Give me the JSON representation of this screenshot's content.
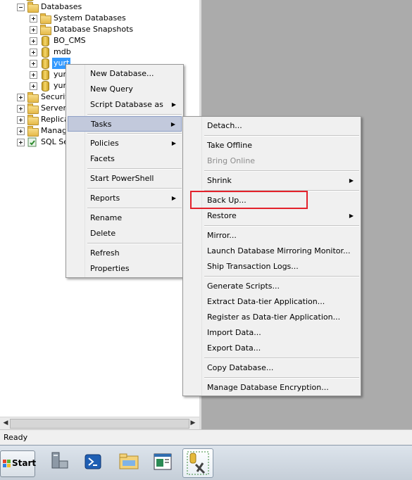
{
  "tree": {
    "items": [
      {
        "label": "Databases",
        "expanded": true
      },
      {
        "label": "System Databases"
      },
      {
        "label": "Database Snapshots"
      },
      {
        "label": "BO_CMS"
      },
      {
        "label": "mdb"
      },
      {
        "label": "yurt"
      },
      {
        "label": "yur"
      },
      {
        "label": "yur"
      },
      {
        "label": "Securit"
      },
      {
        "label": "Server"
      },
      {
        "label": "Replica"
      },
      {
        "label": "Manage"
      },
      {
        "label": "SQL Se"
      }
    ]
  },
  "context_menu": {
    "items": [
      {
        "label": "New Database..."
      },
      {
        "label": "New Query"
      },
      {
        "label": "Script Database as",
        "submenu": true
      },
      {
        "label": "Tasks",
        "submenu": true,
        "highlighted": true
      },
      {
        "label": "Policies",
        "submenu": true
      },
      {
        "label": "Facets"
      },
      {
        "label": "Start PowerShell"
      },
      {
        "label": "Reports",
        "submenu": true
      },
      {
        "label": "Rename"
      },
      {
        "label": "Delete"
      },
      {
        "label": "Refresh"
      },
      {
        "label": "Properties"
      }
    ]
  },
  "tasks_menu": {
    "items": [
      {
        "label": "Detach..."
      },
      {
        "label": "Take Offline"
      },
      {
        "label": "Bring Online",
        "disabled": true
      },
      {
        "label": "Shrink",
        "submenu": true
      },
      {
        "label": "Back Up..."
      },
      {
        "label": "Restore",
        "submenu": true
      },
      {
        "label": "Mirror..."
      },
      {
        "label": "Launch Database Mirroring Monitor..."
      },
      {
        "label": "Ship Transaction Logs..."
      },
      {
        "label": "Generate Scripts..."
      },
      {
        "label": "Extract Data-tier Application..."
      },
      {
        "label": "Register as Data-tier Application..."
      },
      {
        "label": "Import Data..."
      },
      {
        "label": "Export Data..."
      },
      {
        "label": "Copy Database..."
      },
      {
        "label": "Manage Database Encryption..."
      }
    ]
  },
  "status": {
    "text": "Ready"
  },
  "taskbar": {
    "start_label": "Start"
  },
  "colors": {
    "highlight_box": "#e3212b",
    "menu_hot": "#c2c9dc"
  }
}
